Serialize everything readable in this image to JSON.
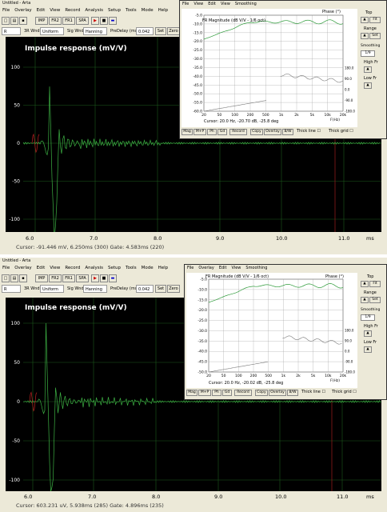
{
  "top": {
    "window_title": "Untitled - Arta",
    "menu": [
      "File",
      "Overlay",
      "Edit",
      "View",
      "Record",
      "Analysis",
      "Setup",
      "Tools",
      "Mode",
      "Help"
    ],
    "toolbar_buttons": [
      "IMP",
      "FR2",
      "FR1",
      "SPA"
    ],
    "toolbar2": {
      "channel": "R",
      "window_label": "3R Wnd",
      "window_value": "Uniform",
      "sig_wnd_label": "Sig Wnd",
      "sig_wnd_value": "Hanning",
      "predelay_label": "PreDelay (ms)",
      "predelay_value": "0.042",
      "set": "Set",
      "zero": "Zero"
    },
    "plot_title": "Impulse response (mV/V)",
    "y_ticks": [
      "100",
      "50",
      "0",
      "-50",
      "-100"
    ],
    "x_ticks": [
      "6.0",
      "7.0",
      "8.0",
      "9.0",
      "10.0",
      "11.0",
      "ms"
    ],
    "cursor": "Cursor: -91.446 mV, 6.250ms (300)   Gate: 4.583ms (220)",
    "fr": {
      "menu": [
        "File",
        "View",
        "Edit",
        "View",
        "Smoothing"
      ],
      "title": "FR Magnitude (dB V/V - 1/6 oct)",
      "phase": "Phase (°)",
      "y_ticks": [
        "-5.0",
        "-10.0",
        "-15.0",
        "-20.0",
        "-25.0",
        "-30.0",
        "-35.0",
        "-40.0",
        "-45.0",
        "-50.0",
        "-55.0",
        "-60.0"
      ],
      "phase_ticks": [
        "180.0",
        "90.0",
        "0.0",
        "-90.0",
        "-180.0"
      ],
      "x_ticks": [
        "20",
        "50",
        "100",
        "200",
        "500",
        "1k",
        "2k",
        "5k",
        "10k",
        "20k"
      ],
      "xunit": "F(Hz)",
      "cursor": "Cursor: 20.0 Hz, -20.70 dB, -25.8 deg",
      "buttons": [
        "Mag",
        "M+P",
        "Ph",
        "Gd",
        "Record",
        "Copy",
        "Overlay",
        "B/W"
      ],
      "thick_line": "Thick line",
      "thick_grid": "Thick grid",
      "side": {
        "top": "Top",
        "fit": "Fit",
        "range": "Range",
        "set": "Set",
        "smoothing": "Smoothing",
        "smooth_val": "1/9",
        "high_fr": "High Fr",
        "low_fr": "Low Fr",
        "arta": "A R T A"
      }
    }
  },
  "bot": {
    "window_title": "Untitled - Arta",
    "menu": [
      "File",
      "Overlay",
      "Edit",
      "View",
      "Record",
      "Analysis",
      "Setup",
      "Tools",
      "Mode",
      "Help"
    ],
    "toolbar_buttons": [
      "IMP",
      "FR2",
      "FR1",
      "SPA"
    ],
    "toolbar2": {
      "channel": "R",
      "window_label": "3R Wnd",
      "window_value": "Uniform",
      "sig_wnd_label": "Sig Wnd",
      "sig_wnd_value": "Hanning",
      "predelay_label": "PreDelay (ms)",
      "predelay_value": "0.042",
      "set": "Set",
      "zero": "Zero"
    },
    "plot_title": "Impulse response (mV/V)",
    "y_ticks": [
      "100",
      "50",
      "0",
      "-50",
      "-100"
    ],
    "x_ticks": [
      "6.0",
      "7.0",
      "8.0",
      "9.0",
      "10.0",
      "11.0",
      "ms"
    ],
    "cursor": "Cursor: 603.231 uV, 5.938ms (285)   Gate: 4.896ms (235)",
    "fr": {
      "menu": [
        "File",
        "Overlay",
        "Edit",
        "View",
        "Smoothing"
      ],
      "title": "FR Magnitude (dB V/V - 1/6 oct)",
      "phase": "Phase (°)",
      "y_ticks": [
        "-5.0",
        "-10.0",
        "-15.0",
        "-20.0",
        "-25.0",
        "-30.0",
        "-35.0",
        "-40.0",
        "-45.0",
        "-50.0"
      ],
      "phase_ticks": [
        "180.0",
        "90.0",
        "0.0",
        "-90.0",
        "-180.0"
      ],
      "x_ticks": [
        "20",
        "50",
        "100",
        "200",
        "500",
        "1k",
        "2k",
        "5k",
        "10k",
        "20k"
      ],
      "xunit": "F(Hz)",
      "cursor": "Cursor: 20.0 Hz, -20.02 dB, -25.8 deg",
      "buttons": [
        "Mag",
        "M+P",
        "Ph",
        "Gd",
        "Record",
        "Copy",
        "Overlay",
        "B/W"
      ],
      "thick_line": "Thick line",
      "thick_grid": "Thick grid",
      "side": {
        "top": "Top",
        "fit": "Fit",
        "range": "Range",
        "set": "Set",
        "smoothing": "Smoothing",
        "smooth_val": "1/9",
        "high_fr": "High Fr",
        "low_fr": "Low Fr",
        "arta": "A R T A"
      }
    }
  },
  "colors": {
    "plot_bg": "#000000",
    "trace": "#3cb043",
    "grid": "#1d5a1d",
    "gate_marker": "#8b1a1a",
    "fr_trace": "#2e9b3a",
    "phase_trace": "#7a7a7a"
  }
}
